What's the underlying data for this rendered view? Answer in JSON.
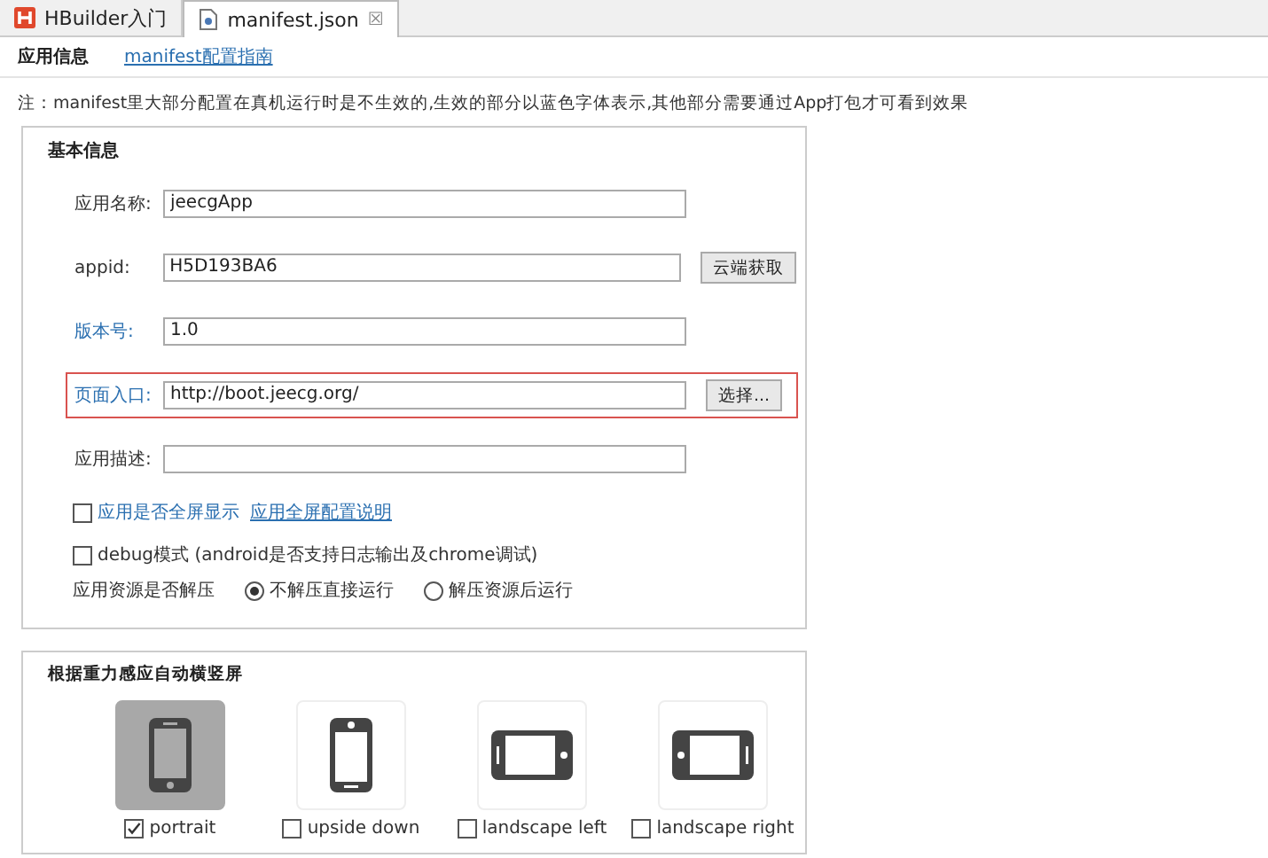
{
  "editor_tabs": [
    {
      "label": "HBuilder入门",
      "kind": "hbuilder",
      "selected": false
    },
    {
      "label": "manifest.json",
      "kind": "file",
      "selected": true,
      "close": "☒"
    }
  ],
  "page_tabs": [
    {
      "label": "应用信息",
      "kind": "tab",
      "selected": true
    },
    {
      "label": "manifest配置指南",
      "kind": "link",
      "selected": false
    }
  ],
  "note": "注：manifest里大部分配置在真机运行时是不生效的,生效的部分以蓝色字体表示,其他部分需要通过App打包才可看到效果",
  "basic_info": {
    "title": "基本信息",
    "fields": [
      {
        "label": "应用名称:",
        "value": "jeecgApp",
        "effective": false,
        "highlighted": false
      },
      {
        "label": "appid:",
        "value": "H5D193BA6",
        "effective": false,
        "highlighted": false,
        "button": "云端获取"
      },
      {
        "label": "版本号:",
        "value": "1.0",
        "effective": true,
        "highlighted": false
      },
      {
        "label": "页面入口:",
        "value": "http://boot.jeecg.org/",
        "effective": true,
        "highlighted": true,
        "button": "选择..."
      },
      {
        "label": "应用描述:",
        "effective": false,
        "highlighted": false
      }
    ],
    "checkboxes": [
      {
        "label": "应用是否全屏显示",
        "effective": true,
        "checked": false,
        "link": "应用全屏配置说明"
      },
      {
        "label": "debug模式 (android是否支持日志输出及chrome调试)",
        "effective": false,
        "checked": false
      }
    ],
    "unzip": {
      "label": "应用资源是否解压",
      "options": [
        {
          "label": "不解压直接运行",
          "selected": true
        },
        {
          "label": "解压资源后运行",
          "selected": false
        }
      ]
    }
  },
  "orientation": {
    "title": "根据重力感应自动横竖屏",
    "items": [
      {
        "label": "portrait",
        "kind": "portrait",
        "selected": true,
        "checked": true
      },
      {
        "label": "upside down",
        "kind": "upside-down",
        "selected": false,
        "checked": false
      },
      {
        "label": "landscape left",
        "kind": "landscape-left",
        "selected": false,
        "checked": false
      },
      {
        "label": "landscape right",
        "kind": "landscape-right",
        "selected": false,
        "checked": false
      }
    ]
  }
}
